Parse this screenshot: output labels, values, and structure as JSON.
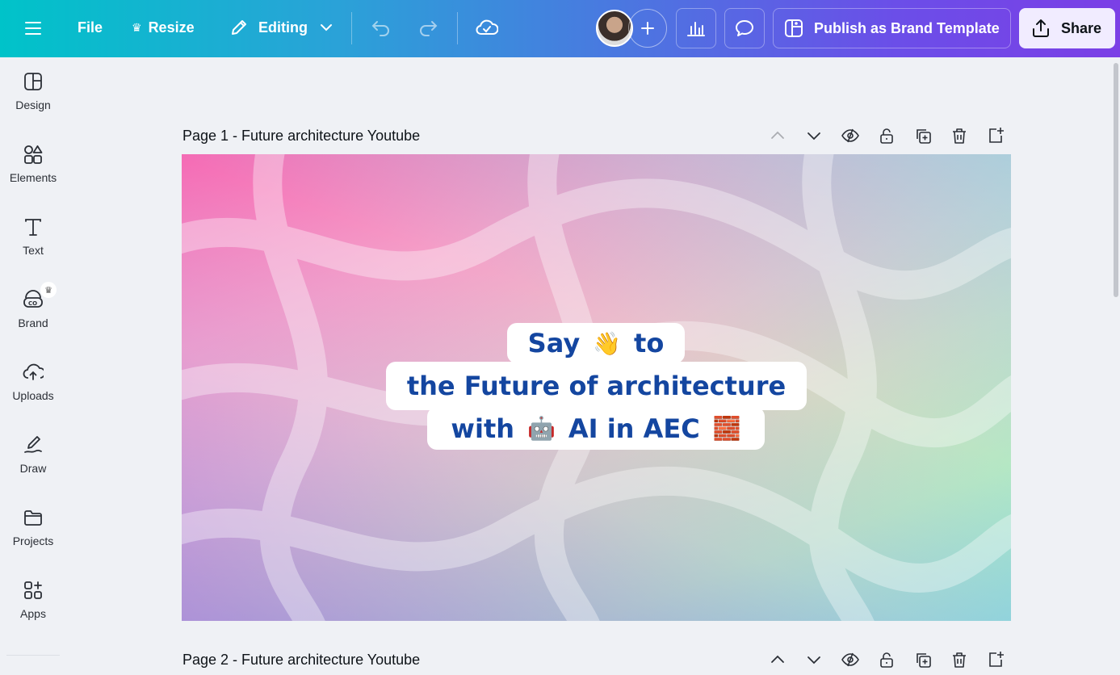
{
  "topbar": {
    "file_label": "File",
    "resize_label": "Resize",
    "editing_label": "Editing",
    "publish_label": "Publish as Brand Template",
    "share_label": "Share"
  },
  "sidebar": {
    "items": [
      {
        "label": "Design",
        "icon": "design-icon"
      },
      {
        "label": "Elements",
        "icon": "elements-icon"
      },
      {
        "label": "Text",
        "icon": "text-icon"
      },
      {
        "label": "Brand",
        "icon": "brand-icon"
      },
      {
        "label": "Uploads",
        "icon": "uploads-icon"
      },
      {
        "label": "Draw",
        "icon": "draw-icon"
      },
      {
        "label": "Projects",
        "icon": "projects-icon"
      },
      {
        "label": "Apps",
        "icon": "apps-icon"
      }
    ]
  },
  "pages": [
    {
      "title": "Page 1 - Future architecture Youtube"
    },
    {
      "title": "Page 2 - Future architecture Youtube"
    }
  ],
  "canvas": {
    "line1_a": "Say",
    "line1_emoji": "👋",
    "line1_b": "to",
    "line2": "the Future of architecture",
    "line3_a": "with",
    "line3_emoji": "🤖",
    "line3_b": "AI in AEC",
    "line3_emoji2": "🧱"
  },
  "colors": {
    "headline_text": "#1446a0",
    "share_bg": "#f1ecff"
  }
}
